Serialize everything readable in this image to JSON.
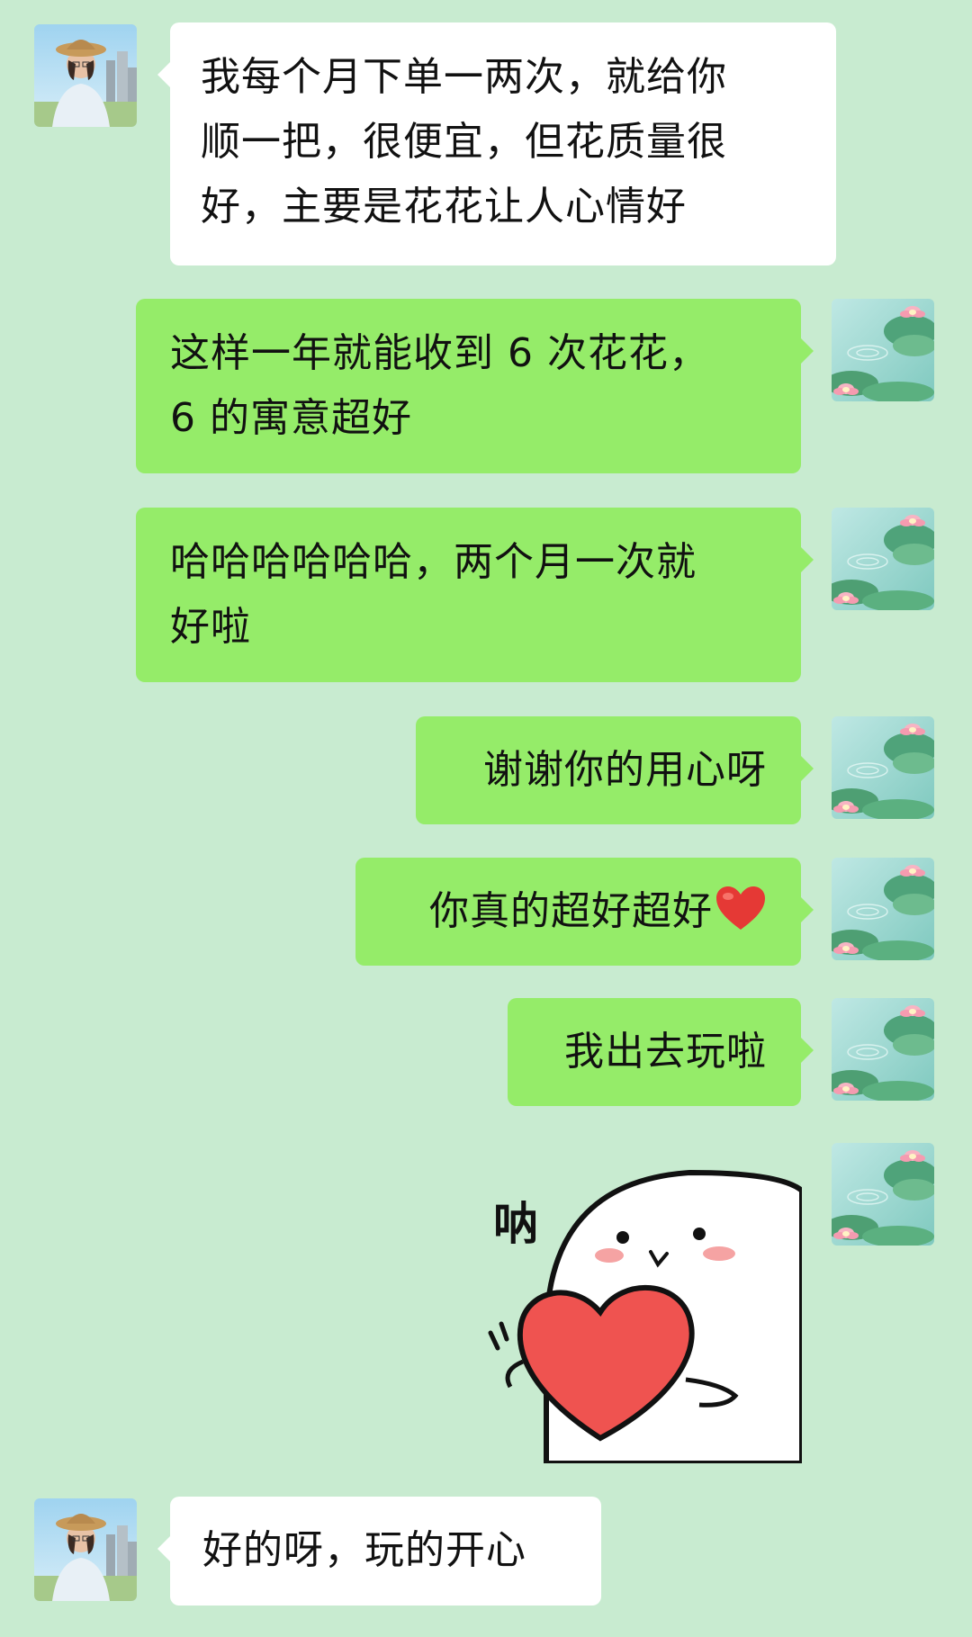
{
  "messages": [
    {
      "sender": "friend",
      "text_lines": [
        "我每个月下单一两次，就给你",
        "顺一把，很便宜，但花质量很",
        "好，主要是花花让人心情好"
      ]
    },
    {
      "sender": "me",
      "text_lines": [
        "这样一年就能收到 6 次花花，",
        "6 的寓意超好"
      ]
    },
    {
      "sender": "me",
      "text_lines": [
        "哈哈哈哈哈哈，两个月一次就",
        "好啦"
      ]
    },
    {
      "sender": "me",
      "text_lines": [
        "谢谢你的用心呀"
      ]
    },
    {
      "sender": "me",
      "text": "你真的超好超好",
      "emoji": "red-heart"
    },
    {
      "sender": "me",
      "text_lines": [
        "我出去玩啦"
      ]
    },
    {
      "sender": "me",
      "type": "sticker",
      "sticker_text": "呐"
    },
    {
      "sender": "friend",
      "text_lines": [
        "好的呀，玩的开心"
      ]
    }
  ],
  "colors": {
    "chat_background": "#c8ebd0",
    "incoming_bubble": "#ffffff",
    "outgoing_bubble": "#95ec69",
    "heart": "#ef5350"
  },
  "icons": {
    "friend_avatar": "person-with-straw-hat-photo",
    "my_avatar": "lotus-pond-illustration"
  }
}
